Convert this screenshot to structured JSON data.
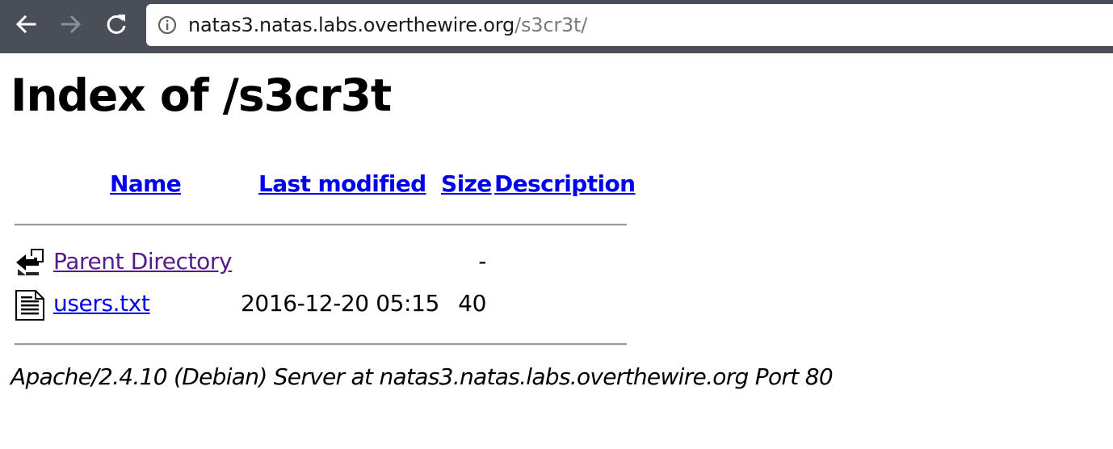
{
  "browser": {
    "url_host": "natas3.natas.labs.overthewire.org",
    "url_path": "/s3cr3t/",
    "icons": {
      "back": "arrow-left-icon",
      "forward": "arrow-right-icon",
      "reload": "reload-icon",
      "info": "info-circle-icon"
    }
  },
  "page": {
    "title": "Index of /s3cr3t",
    "columns": {
      "name": "Name",
      "last_modified": "Last modified",
      "size": "Size",
      "description": "Description"
    },
    "rows": [
      {
        "icon": "back-arrow-icon",
        "name": "Parent Directory",
        "last_modified": "",
        "size": "-",
        "description": ""
      },
      {
        "icon": "text-file-icon",
        "name": "users.txt",
        "last_modified": "2016-12-20 05:15",
        "size": "40",
        "description": ""
      }
    ],
    "server_signature": "Apache/2.4.10 (Debian) Server at natas3.natas.labs.overthewire.org Port 80"
  },
  "colors": {
    "toolbar": "#4a4f57",
    "link": "#0000ee",
    "visited_link": "#551a8b"
  }
}
